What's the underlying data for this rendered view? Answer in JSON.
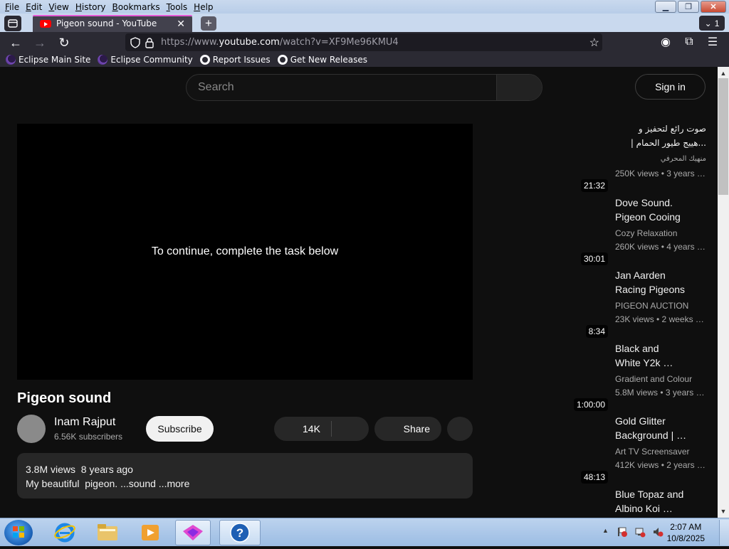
{
  "menubar": {
    "items": [
      "File",
      "Edit",
      "View",
      "History",
      "Bookmarks",
      "Tools",
      "Help"
    ]
  },
  "tab": {
    "title": "Pigeon sound - YouTube",
    "count": "1"
  },
  "urlbar": {
    "prefix": "https://www.",
    "domain": "youtube.com",
    "path": "/watch?v=XF9Me96KMU4"
  },
  "bookmarks": [
    "Eclipse Main Site",
    "Eclipse Community",
    "Report Issues",
    "Get New Releases"
  ],
  "header": {
    "search_placeholder": "Search",
    "signin": "Sign in"
  },
  "player": {
    "message": "To continue, complete the task below"
  },
  "video": {
    "title": "Pigeon sound",
    "channel": "Inam Rajput",
    "subscribers": "6.56K subscribers",
    "subscribe_label": "Subscribe",
    "likes": "14K",
    "share_label": "Share",
    "description_meta": "3.8M views  8 years ago",
    "description_text": "My beautiful  pigeon. ...sound ...more"
  },
  "recommendations": [
    {
      "line1": "صوت رائع لتحفيز و",
      "line2": "...هييج طيور الحمام |",
      "channel": "منهيك المحرفي",
      "views": "250K views • 3 years ago",
      "duration": "21:32",
      "rtl": true
    },
    {
      "line1": "Dove Sound.",
      "line2": "Pigeon Cooing",
      "channel": "Cozy Relaxation",
      "views": "260K views • 4 years ago",
      "duration": "30:01",
      "rtl": false
    },
    {
      "line1": "Jan Aarden",
      "line2": "Racing Pigeons",
      "channel": "PIGEON AUCTION",
      "views": "23K views • 2 weeks ago",
      "duration": "8:34",
      "rtl": false
    },
    {
      "line1": "Black and",
      "line2": "White Y2k …",
      "channel": "Gradient and Colour",
      "views": "5.8M views • 3 years ago",
      "duration": "1:00:00",
      "rtl": false
    },
    {
      "line1": "Gold Glitter",
      "line2": "Background | …",
      "channel": "Art TV Screensaver",
      "views": "412K views • 2 years ago",
      "duration": "48:13",
      "rtl": false
    },
    {
      "line1": "Blue Topaz and",
      "line2": "Albino Koi …",
      "channel": "",
      "views": "",
      "duration": "",
      "rtl": false
    }
  ],
  "taskbar": {
    "time": "2:07 AM",
    "date": "10/8/2025"
  }
}
